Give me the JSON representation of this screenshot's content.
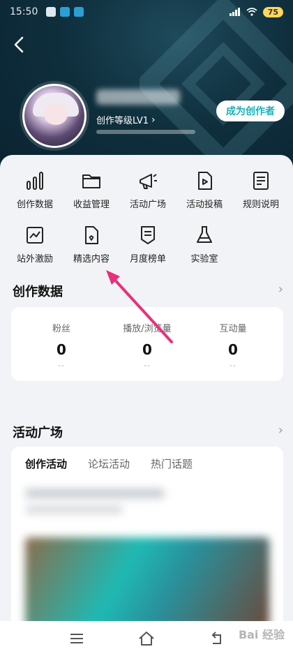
{
  "status_bar": {
    "time": "15:50",
    "battery": "75"
  },
  "profile": {
    "level_label": "创作等级LV1",
    "become_creator": "成为创作者"
  },
  "tools": [
    {
      "label": "创作数据",
      "icon": "bar-chart-icon"
    },
    {
      "label": "收益管理",
      "icon": "folder-icon"
    },
    {
      "label": "活动广场",
      "icon": "megaphone-icon"
    },
    {
      "label": "活动投稿",
      "icon": "video-file-icon"
    },
    {
      "label": "规则说明",
      "icon": "document-icon"
    },
    {
      "label": "站外激励",
      "icon": "trend-chart-icon"
    },
    {
      "label": "精选内容",
      "icon": "document-badge-icon"
    },
    {
      "label": "月度榜单",
      "icon": "ranking-icon"
    },
    {
      "label": "实验室",
      "icon": "flask-icon"
    }
  ],
  "creation_data": {
    "title": "创作数据",
    "stats": [
      {
        "label": "粉丝",
        "value": "0",
        "sub": "--"
      },
      {
        "label": "播放/浏览量",
        "value": "0",
        "sub": "--"
      },
      {
        "label": "互动量",
        "value": "0",
        "sub": "--"
      }
    ]
  },
  "activity": {
    "title": "活动广场",
    "tabs": [
      "创作活动",
      "论坛活动",
      "热门话题"
    ]
  },
  "watermark": "Bai 经验",
  "colors": {
    "accent": "#16b2b8",
    "annotation_arrow": "#e8307a"
  }
}
